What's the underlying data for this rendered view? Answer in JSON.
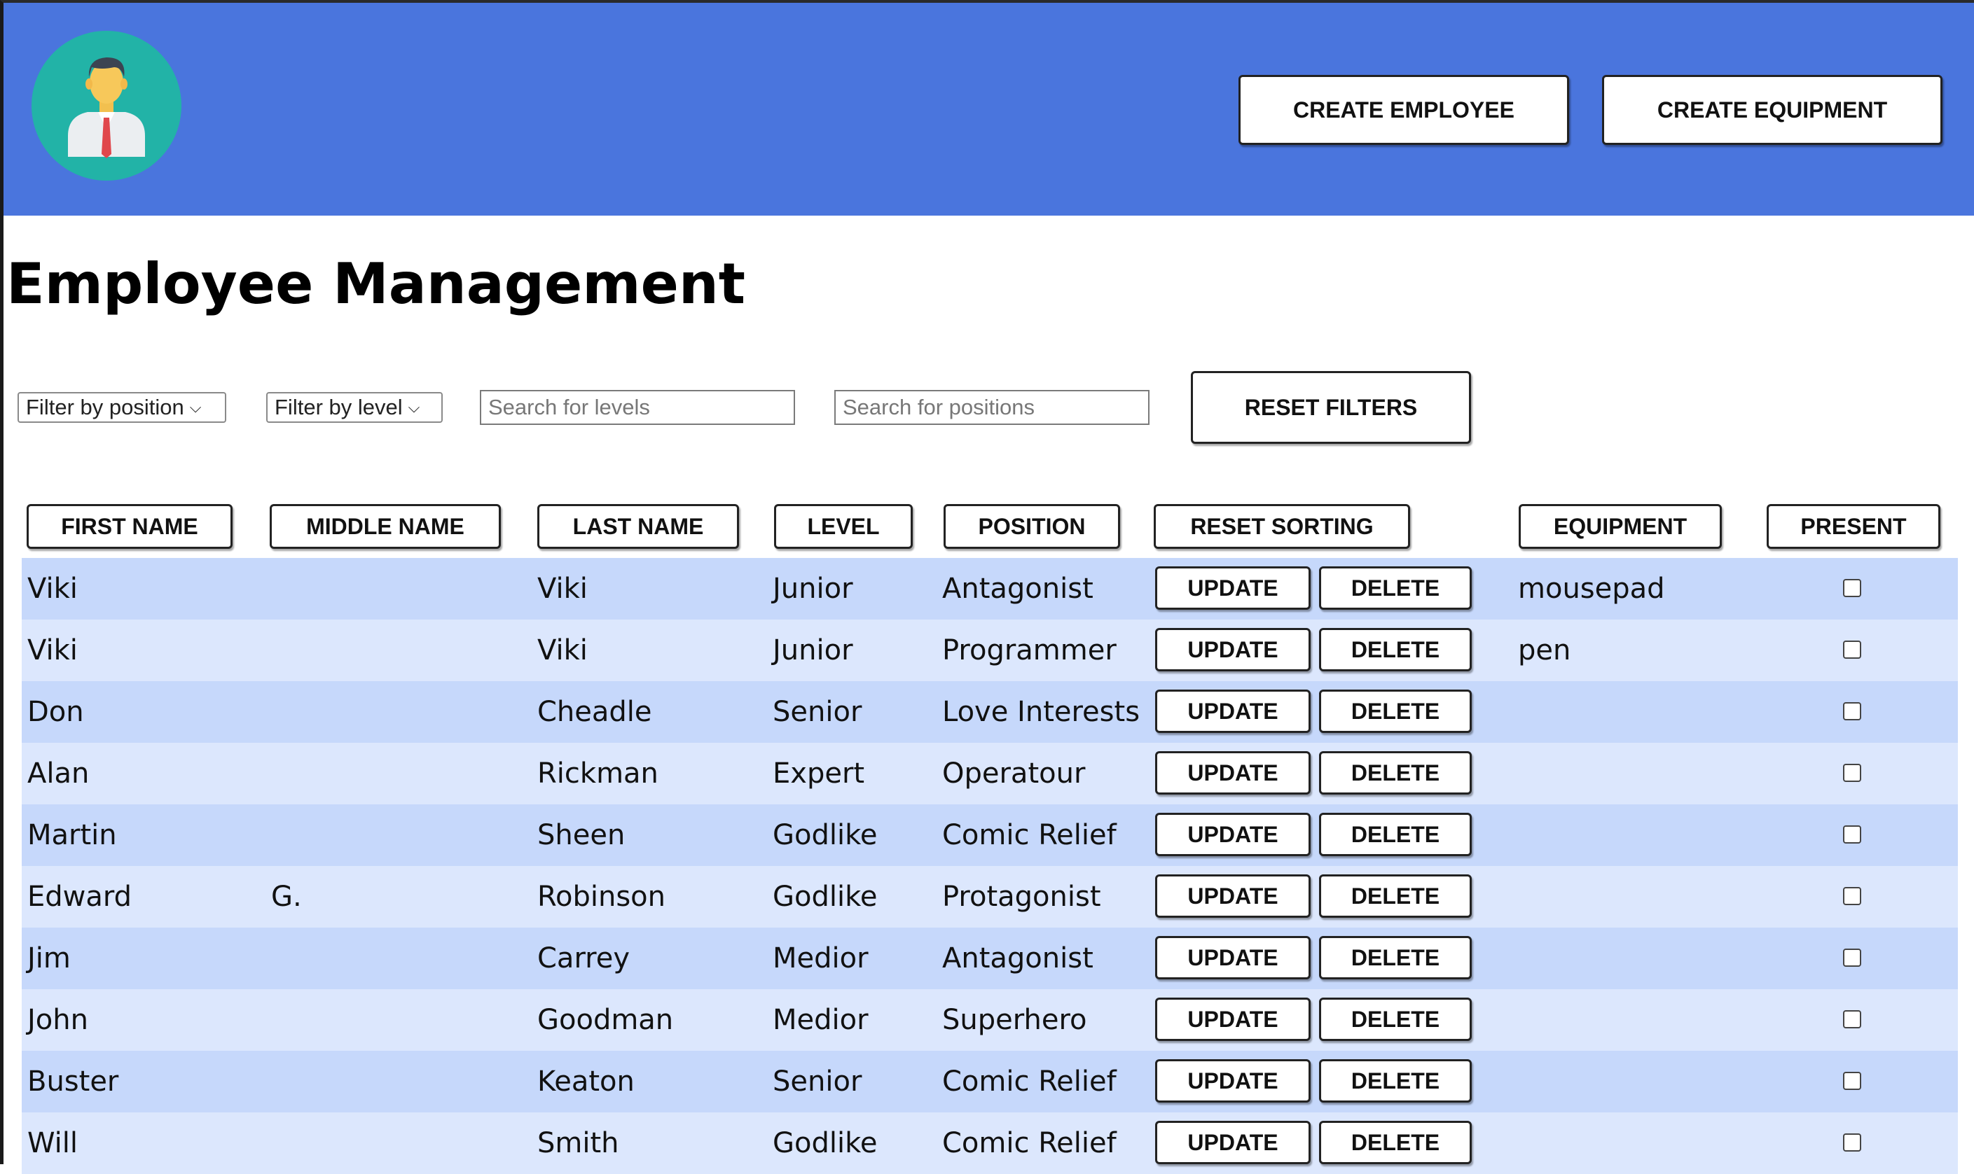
{
  "header": {
    "logo_icon": "businessman-avatar-icon",
    "create_employee_label": "CREATE EMPLOYEE",
    "create_equipment_label": "CREATE EQUIPMENT",
    "background_color": "#4a75dd"
  },
  "page_title": "Employee Management",
  "filters": {
    "position_select": "Filter by position",
    "level_select": "Filter by level",
    "level_search_placeholder": "Search for levels",
    "position_search_placeholder": "Search for positions",
    "reset_filters_label": "RESET FILTERS"
  },
  "columns": {
    "first_name": "FIRST NAME",
    "middle_name": "MIDDLE NAME",
    "last_name": "LAST NAME",
    "level": "LEVEL",
    "position": "POSITION",
    "reset_sorting": "RESET SORTING",
    "equipment": "EQUIPMENT",
    "present": "PRESENT"
  },
  "row_actions": {
    "update_label": "UPDATE",
    "delete_label": "DELETE"
  },
  "rows": [
    {
      "first": "Viki",
      "middle": "",
      "last": "Viki",
      "level": "Junior",
      "position": "Antagonist",
      "equipment": "mousepad",
      "present": false
    },
    {
      "first": "Viki",
      "middle": "",
      "last": "Viki",
      "level": "Junior",
      "position": "Programmer",
      "equipment": "pen",
      "present": false
    },
    {
      "first": "Don",
      "middle": "",
      "last": "Cheadle",
      "level": "Senior",
      "position": "Love Interests",
      "equipment": "",
      "present": false
    },
    {
      "first": "Alan",
      "middle": "",
      "last": "Rickman",
      "level": "Expert",
      "position": "Operatour",
      "equipment": "",
      "present": false
    },
    {
      "first": "Martin",
      "middle": "",
      "last": "Sheen",
      "level": "Godlike",
      "position": "Comic Relief",
      "equipment": "",
      "present": false
    },
    {
      "first": "Edward",
      "middle": "G.",
      "last": "Robinson",
      "level": "Godlike",
      "position": "Protagonist",
      "equipment": "",
      "present": false
    },
    {
      "first": "Jim",
      "middle": "",
      "last": "Carrey",
      "level": "Medior",
      "position": "Antagonist",
      "equipment": "",
      "present": false
    },
    {
      "first": "John",
      "middle": "",
      "last": "Goodman",
      "level": "Medior",
      "position": "Superhero",
      "equipment": "",
      "present": false
    },
    {
      "first": "Buster",
      "middle": "",
      "last": "Keaton",
      "level": "Senior",
      "position": "Comic Relief",
      "equipment": "",
      "present": false
    },
    {
      "first": "Will",
      "middle": "",
      "last": "Smith",
      "level": "Godlike",
      "position": "Comic Relief",
      "equipment": "",
      "present": false
    }
  ]
}
